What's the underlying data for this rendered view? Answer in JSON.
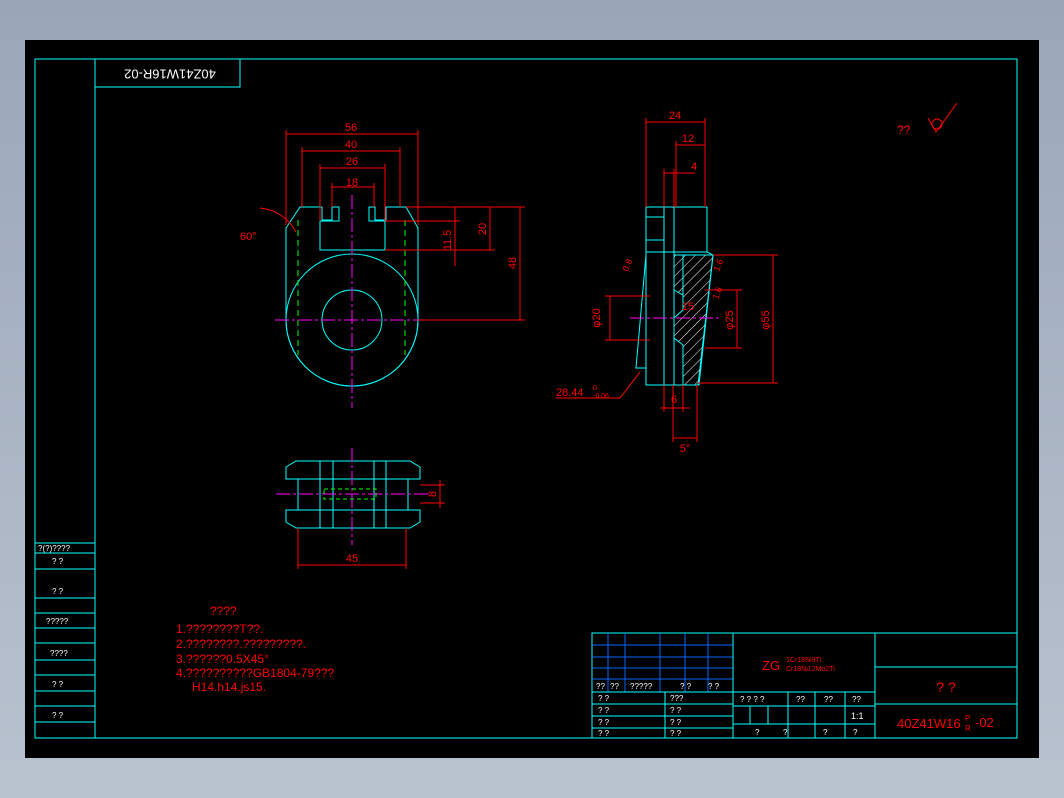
{
  "drawing": {
    "stamp_rotated": "40Z41W16R-02",
    "roughness_mark": "??",
    "dims_front": {
      "d56": "56",
      "d40": "40",
      "d26": "26",
      "d18": "18",
      "d20": "20",
      "d11_5": "11.5",
      "d48": "48",
      "angle60": "60°"
    },
    "dims_side": {
      "d24": "24",
      "d12": "12",
      "d4": "4",
      "d55": "φ55",
      "d25": "φ25",
      "d20": "φ20",
      "d15": "15",
      "d6": "6",
      "angle5": "5°",
      "d28_44": "28.44",
      "tol": "-0.06",
      "tol0": "0",
      "r_a": "0.8",
      "r_b": "1.6",
      "r_c": "1.6"
    },
    "dims_top": {
      "d45": "45",
      "d8": "8"
    }
  },
  "notes": {
    "title": "????",
    "lines": [
      "1.????????T??.",
      "2.????????.?????????.",
      "3.??????0.5X45°",
      "4.??????????GB1804-79???",
      "H14.h14.js15."
    ]
  },
  "left_panel": {
    "header": "?(?)????",
    "rows": [
      "?   ?",
      "?   ?",
      "?????",
      "????",
      "?   ?",
      "?   ?"
    ]
  },
  "title_block": {
    "material_prefix": "ZG",
    "material_line1": "1Cr18Ni9Ti",
    "material_line2": "Cr18Ni12Mo2Ti",
    "part_name": "?   ?",
    "drawing_no": "40Z41W16",
    "drawing_no_super": "P",
    "drawing_no_sub": "R",
    "drawing_no_suffix": "-02",
    "scale": "1:1",
    "sign_header": [
      "??",
      "??",
      "?????",
      "? ?",
      "? ?"
    ],
    "sign_rows_left": [
      "? ?",
      "? ?",
      "? ?",
      "? ?"
    ],
    "sign_rows_mid": [
      "???",
      "? ?",
      "? ?",
      "? ?"
    ],
    "stage_header": [
      "? ? ? ?",
      "??",
      "??",
      "??"
    ],
    "bottom_row": [
      "?",
      "?",
      "?",
      "?"
    ]
  },
  "colors": {
    "frame": "#00ffff",
    "dim": "#ff0000",
    "center": "#ff00ff",
    "hidden": "#00ff00",
    "text": "#ff0000"
  }
}
